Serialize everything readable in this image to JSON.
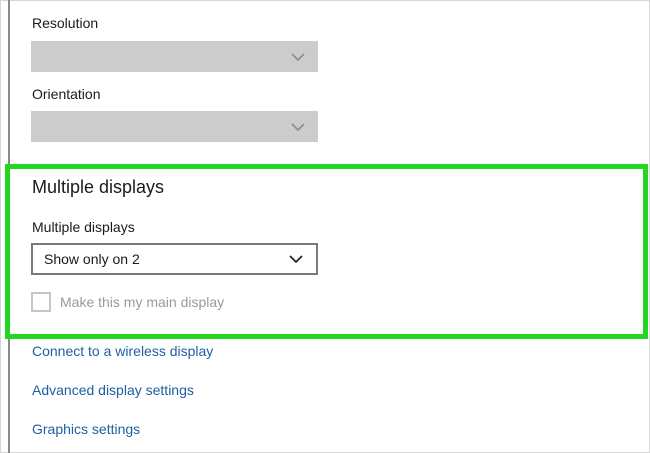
{
  "display": {
    "resolution": {
      "label": "Resolution",
      "value": ""
    },
    "orientation": {
      "label": "Orientation",
      "value": ""
    }
  },
  "multiple_displays": {
    "section_title": "Multiple displays",
    "dropdown_label": "Multiple displays",
    "dropdown_value": "Show only on 2",
    "main_display_checkbox": {
      "label": "Make this my main display",
      "checked": false,
      "enabled": false
    }
  },
  "links": {
    "wireless": "Connect to a wireless display",
    "advanced": "Advanced display settings",
    "graphics": "Graphics settings"
  },
  "colors": {
    "highlight": "#22d622",
    "link": "#1e5fa3",
    "disabled_field": "#cccccc"
  },
  "icons": {
    "dropdown": "chevron-down-icon"
  }
}
